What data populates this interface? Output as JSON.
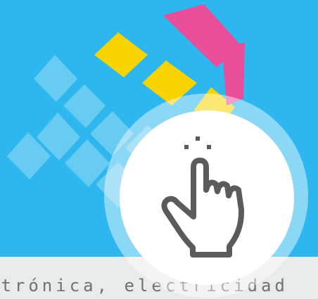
{
  "caption": "ctrónica, electricidad",
  "colors": {
    "background": "#2db7ee",
    "yellow": "#f7d400",
    "pink": "#e94e9a",
    "white": "#ffffff",
    "band": "#e9eaea",
    "icon": "#5a5b5d",
    "text": "#6f7175"
  },
  "icon": "tap-hand-icon"
}
